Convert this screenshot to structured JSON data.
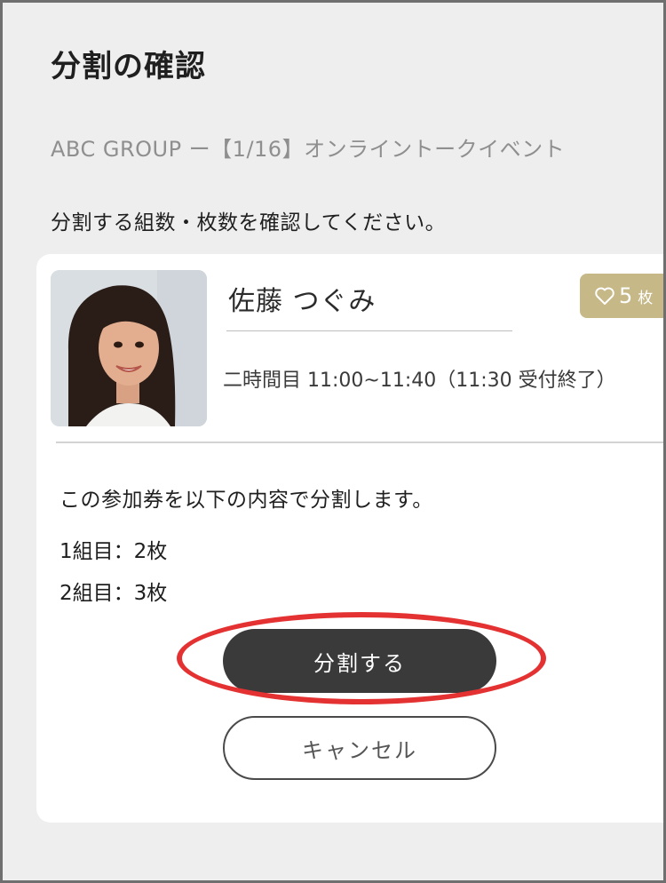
{
  "dialog": {
    "title": "分割の確認",
    "event_name": "ABC GROUP ー【1/16】オンライントークイベント",
    "instruction": "分割する組数・枚数を確認してください。"
  },
  "ticket": {
    "member_name": "佐藤 つぐみ",
    "time_slot": "二時間目 11:00~11:40（11:30 受付終了）",
    "badge": {
      "count": "5",
      "unit": "枚",
      "icon": "heart-icon",
      "color": "#c6b887"
    }
  },
  "split": {
    "intro": "この参加券を以下の内容で分割します。",
    "groups": [
      {
        "text": "1組目：2枚"
      },
      {
        "text": "2組目：3枚"
      }
    ]
  },
  "actions": {
    "split_label": "分割する",
    "cancel_label": "キャンセル"
  },
  "highlight": {
    "color": "#e43232",
    "target": "split-button"
  }
}
